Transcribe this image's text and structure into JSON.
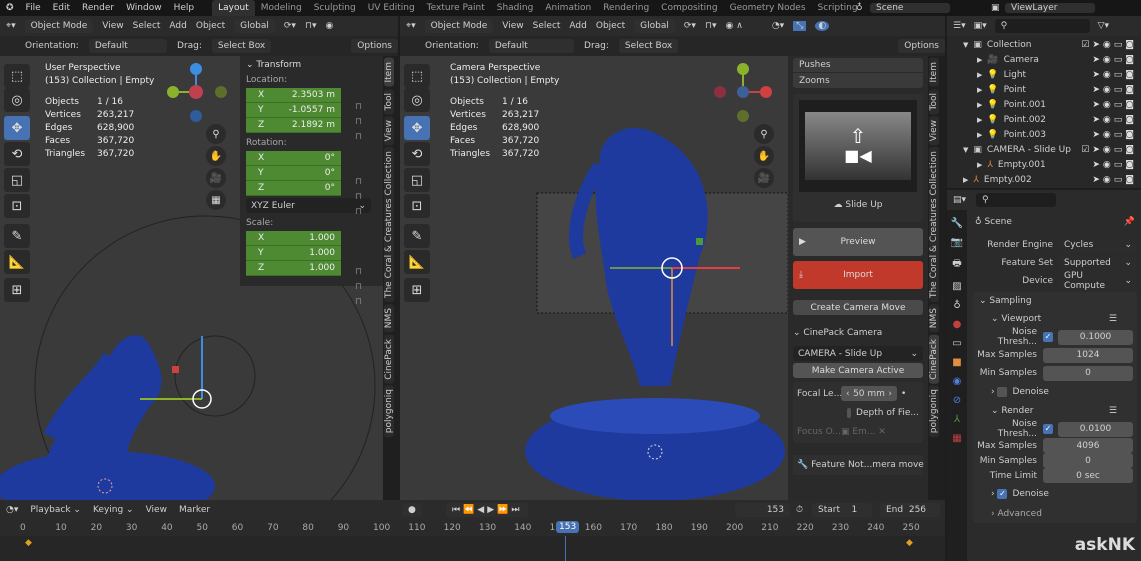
{
  "topbar": {
    "menus": [
      "File",
      "Edit",
      "Render",
      "Window",
      "Help"
    ],
    "workspaces": [
      "Layout",
      "Modeling",
      "Sculpting",
      "UV Editing",
      "Texture Paint",
      "Shading",
      "Animation",
      "Rendering",
      "Compositing",
      "Geometry Nodes",
      "Scripting"
    ],
    "active_workspace": "Layout",
    "add": "+",
    "scene": "Scene",
    "view_layer": "ViewLayer"
  },
  "header": {
    "mode": "Object Mode",
    "menus": [
      "View",
      "Select",
      "Add",
      "Object"
    ],
    "orientation_global": "Global",
    "orientation_label": "Orientation:",
    "orientation_value": "Default",
    "drag_label": "Drag:",
    "drag_value": "Select Box",
    "options": "Options"
  },
  "left_viewport": {
    "title": "User Perspective",
    "subtitle": "(153) Collection | Empty",
    "stats": [
      [
        "Objects",
        "1 / 16"
      ],
      [
        "Vertices",
        "263,217"
      ],
      [
        "Edges",
        "628,900"
      ],
      [
        "Faces",
        "367,720"
      ],
      [
        "Triangles",
        "367,720"
      ]
    ]
  },
  "right_viewport": {
    "title": "Camera Perspective",
    "subtitle": "(153) Collection | Empty",
    "stats": [
      [
        "Objects",
        "1 / 16"
      ],
      [
        "Vertices",
        "263,217"
      ],
      [
        "Edges",
        "628,900"
      ],
      [
        "Faces",
        "367,720"
      ],
      [
        "Triangles",
        "367,720"
      ]
    ]
  },
  "transform": {
    "title": "Transform",
    "location_label": "Location:",
    "location": [
      [
        "X",
        "2.3503 m"
      ],
      [
        "Y",
        "-1.0557 m"
      ],
      [
        "Z",
        "2.1892 m"
      ]
    ],
    "rotation_label": "Rotation:",
    "rotation": [
      [
        "X",
        "0°"
      ],
      [
        "Y",
        "0°"
      ],
      [
        "Z",
        "0°"
      ]
    ],
    "rotation_mode": "XYZ Euler",
    "scale_label": "Scale:",
    "scale": [
      [
        "X",
        "1.000"
      ],
      [
        "Y",
        "1.000"
      ],
      [
        "Z",
        "1.000"
      ]
    ]
  },
  "left_tabs": [
    "Item",
    "Tool",
    "View",
    "The Coral & Creatures Collection",
    "NMS",
    "CinePack",
    "polygoniq"
  ],
  "right_tabs": [
    "Item",
    "Tool",
    "View",
    "The Coral & Creatures Collection",
    "NMS",
    "CinePack",
    "polygoniq"
  ],
  "cinepack": {
    "list": [
      "Pushes",
      "Zooms"
    ],
    "preset": "Slide Up",
    "preview": "Preview",
    "import": "Import",
    "create": "Create Camera Move",
    "section": "CinePack Camera",
    "camera": "CAMERA - Slide Up",
    "make_active": "Make Camera Active",
    "focal_label": "Focal Le...",
    "focal_value": "50 mm",
    "dof": "Depth of Fie...",
    "focus_label": "Focus O...",
    "focus_value": "Em...",
    "feature": "Feature Not...mera move",
    "import_color": "#c0392b"
  },
  "outliner": {
    "rows": [
      {
        "name": "Collection",
        "depth": 0,
        "type": "collection"
      },
      {
        "name": "Camera",
        "depth": 1,
        "type": "camera"
      },
      {
        "name": "Light",
        "depth": 1,
        "type": "light"
      },
      {
        "name": "Point",
        "depth": 1,
        "type": "light"
      },
      {
        "name": "Point.001",
        "depth": 1,
        "type": "light"
      },
      {
        "name": "Point.002",
        "depth": 1,
        "type": "light"
      },
      {
        "name": "Point.003",
        "depth": 1,
        "type": "light"
      },
      {
        "name": "CAMERA - Slide Up",
        "depth": 0,
        "type": "collection"
      },
      {
        "name": "Empty.001",
        "depth": 1,
        "type": "empty"
      },
      {
        "name": "Empty.002",
        "depth": 0,
        "type": "empty"
      }
    ]
  },
  "properties": {
    "context": "Scene",
    "render_engine_label": "Render Engine",
    "render_engine": "Cycles",
    "feature_set_label": "Feature Set",
    "feature_set": "Supported",
    "device_label": "Device",
    "device": "GPU Compute",
    "sampling": "Sampling",
    "viewport": "Viewport",
    "vp_noise_label": "Noise Thresh...",
    "vp_noise": "0.1000",
    "vp_max_label": "Max Samples",
    "vp_max": "1024",
    "vp_min_label": "Min Samples",
    "vp_min": "0",
    "vp_denoise": "Denoise",
    "render": "Render",
    "r_noise_label": "Noise Thresh...",
    "r_noise": "0.0100",
    "r_max_label": "Max Samples",
    "r_max": "4096",
    "r_min_label": "Min Samples",
    "r_min": "0",
    "r_time_label": "Time Limit",
    "r_time": "0 sec",
    "r_denoise": "Denoise",
    "advanced": "Advanced"
  },
  "timeline": {
    "menus": [
      "Playback",
      "Keying",
      "View",
      "Marker"
    ],
    "current": "153",
    "start_label": "Start",
    "start": "1",
    "end_label": "End",
    "end": "256",
    "ticks": [
      "0",
      "10",
      "20",
      "30",
      "40",
      "50",
      "60",
      "70",
      "80",
      "90",
      "100",
      "110",
      "120",
      "130",
      "140",
      "150",
      "160",
      "170",
      "180",
      "190",
      "200",
      "210",
      "220",
      "230",
      "240",
      "250"
    ]
  },
  "watermark": "askNK",
  "colors": {
    "accent": "#4772b3",
    "field_green": "#4d8a32",
    "model_blue": "#1f3a9e"
  }
}
